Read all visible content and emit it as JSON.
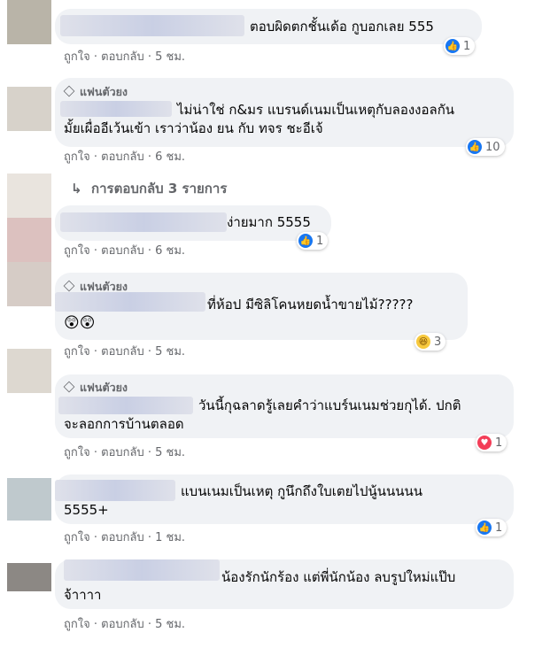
{
  "comments": [
    {
      "text": "ตอบผิดตกชั้นเด้อ กูบอกเลย 555",
      "reaction": {
        "icon": "like-icon",
        "count": "1"
      },
      "time": "5 ชม."
    },
    {
      "badge": "แฟนตัวยง",
      "text_line1": "ไม่น่าใช่ ก&มร แบรนด์เนมเป็นเหตุกับลองงอลกัน",
      "text_line2": "มั้ยเผื่ออีเว้นเข้า เราว่าน้อง ยน กับ ทจร ชะอีเจ้",
      "reaction": {
        "icon": "like-icon",
        "count": "10"
      },
      "time": "6 ชม."
    },
    {
      "text": "ง่ายมาก 5555",
      "reaction": {
        "icon": "like-icon",
        "count": "1"
      },
      "time": "6 ชม."
    },
    {
      "badge": "แฟนตัวยง",
      "text": "ที่ห้อป มีซิลิโคนหยดน้ำขายไม้?????",
      "emojis": "😲😲",
      "reaction": {
        "icon": "haha-icon",
        "count": "3"
      },
      "time": "5 ชม."
    },
    {
      "badge": "แฟนตัวยง",
      "text_line1": "วันนี้กุฉลาดรู้เลยคำว่าแบร์นเนมช่วยกุได้. ปกติ",
      "text_line2": "จะลอกการบ้านตลอด",
      "reaction": {
        "icon": "love-icon",
        "count": "1"
      },
      "time": "5 ชม."
    },
    {
      "text_line1": "แบนเนมเป็นเหตุ กูนึกถึงใบเตยไปนู้นนนนน",
      "text_line2": "5555+",
      "reaction": {
        "icon": "like-icon",
        "count": "1"
      },
      "time": "1 ชม."
    },
    {
      "text_line1": "น้องรักนักร้อง แต่พี่นักน้อง ลบรูปใหม่แป๊บ",
      "text_line2": "จ้าาาา",
      "time": "5 ชม."
    }
  ],
  "labels": {
    "like": "ถูกใจ",
    "reply": "ตอบกลับ",
    "sep": "·"
  },
  "replies_link": "การตอบกลับ 3 รายการ",
  "colors": {
    "like": "#1877f2",
    "love": "#f33e58",
    "haha": "#f7c93e"
  }
}
